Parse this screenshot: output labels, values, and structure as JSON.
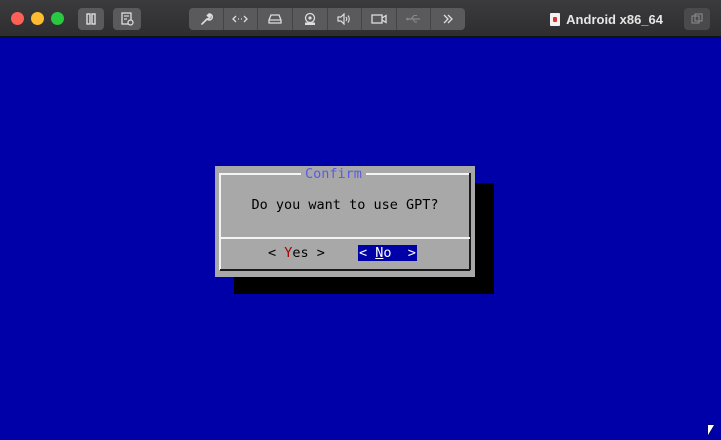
{
  "window": {
    "title": "Android x86_64"
  },
  "toolbar": {
    "pause_icon": "pause-icon",
    "snapshot_icon": "snapshot-icon",
    "groups": [
      {
        "icon": "wrench-icon"
      },
      {
        "icon": "code-arrows-icon"
      },
      {
        "icon": "disk-icon"
      },
      {
        "icon": "camera-user-icon"
      },
      {
        "icon": "speaker-icon"
      },
      {
        "icon": "video-camera-icon"
      },
      {
        "icon": "usb-icon"
      },
      {
        "icon": "chevron-double-right-icon"
      }
    ]
  },
  "dialog": {
    "title": "Confirm",
    "message": "Do you want to use GPT?",
    "yes_prefix": "< ",
    "yes_hotkey": "Y",
    "yes_rest": "es >",
    "no_prefix": "< ",
    "no_hotkey": "N",
    "no_rest": "o  >",
    "selected": "No"
  },
  "colors": {
    "console_bg": "#0000a8",
    "dialog_bg": "#a8a8a8",
    "title_color": "#5a5ae8",
    "hotkey_color": "#a80000"
  }
}
